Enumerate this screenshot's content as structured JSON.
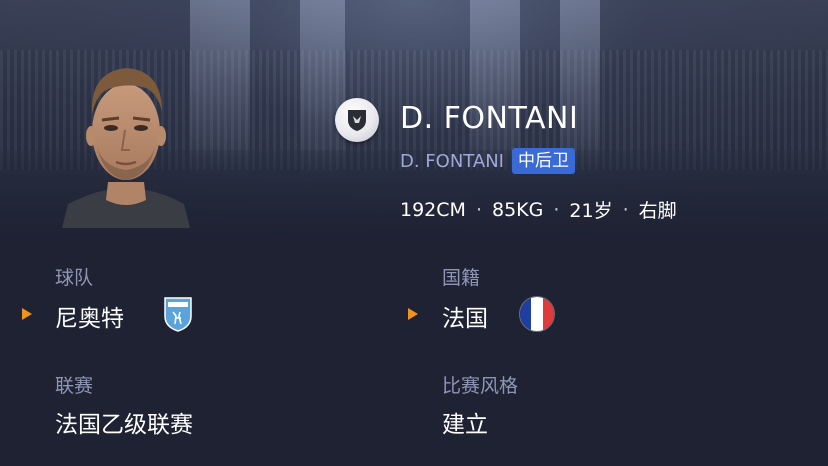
{
  "player": {
    "name": "D. FONTANI",
    "short_name": "D. FONTANI",
    "position": "中后卫",
    "height": "192CM",
    "weight": "85KG",
    "age": "21岁",
    "foot": "右脚",
    "separator": "·"
  },
  "team": {
    "label": "球队",
    "value": "尼奥特",
    "crest_icon": "chamois-niortais-crest-icon"
  },
  "nationality": {
    "label": "国籍",
    "value": "法国",
    "flag_icon": "france-flag-icon"
  },
  "league": {
    "label": "联赛",
    "value": "法国乙级联赛"
  },
  "play_style": {
    "label": "比赛风格",
    "value": "建立"
  },
  "colors": {
    "background": "#1e2233",
    "accent_arrow": "#f0931e",
    "position_badge": "#3a6ad6",
    "label": "#8e96b4",
    "sub_name": "#9ea9d8"
  }
}
